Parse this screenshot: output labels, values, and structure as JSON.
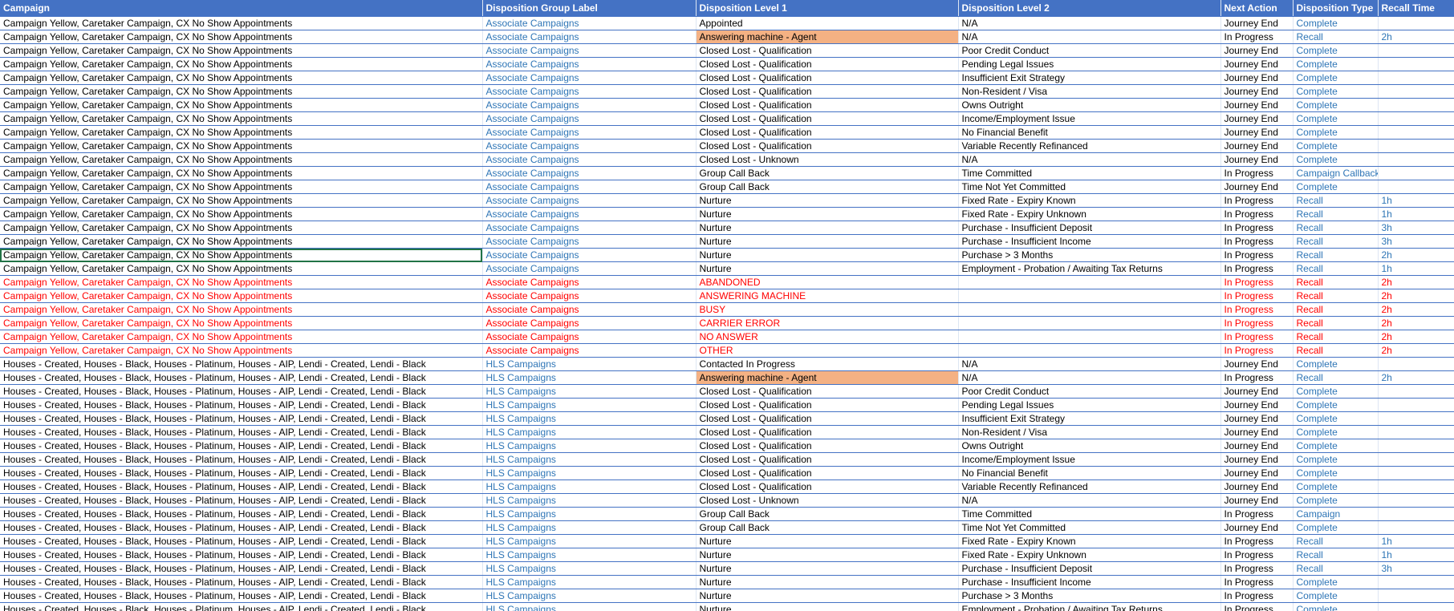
{
  "colors": {
    "header_bg": "#4472c4",
    "link_blue": "#2e75b6",
    "error_red": "#ff0000",
    "highlight": "#f4b183",
    "selection": "#217346"
  },
  "columns": [
    "Campaign",
    "Disposition Group Label",
    "Disposition Level 1",
    "Disposition Level 2",
    "Next Action",
    "Disposition Type",
    "Recall Time"
  ],
  "rows": [
    {
      "c": [
        "Campaign Yellow, Caretaker Campaign, CX No Show Appointments",
        "Associate Campaigns",
        "Appointed",
        "N/A",
        "Journey End",
        "Complete",
        ""
      ]
    },
    {
      "c": [
        "Campaign Yellow, Caretaker Campaign, CX No Show Appointments",
        "Associate Campaigns",
        "Answering machine - Agent",
        "N/A",
        "In Progress",
        "Recall",
        "2h"
      ],
      "hl": true
    },
    {
      "c": [
        "Campaign Yellow, Caretaker Campaign, CX No Show Appointments",
        "Associate Campaigns",
        "Closed Lost - Qualification",
        "Poor Credit Conduct",
        "Journey End",
        "Complete",
        ""
      ]
    },
    {
      "c": [
        "Campaign Yellow, Caretaker Campaign, CX No Show Appointments",
        "Associate Campaigns",
        "Closed Lost - Qualification",
        "Pending Legal Issues",
        "Journey End",
        "Complete",
        ""
      ]
    },
    {
      "c": [
        "Campaign Yellow, Caretaker Campaign, CX No Show Appointments",
        "Associate Campaigns",
        "Closed Lost - Qualification",
        "Insufficient Exit Strategy",
        "Journey End",
        "Complete",
        ""
      ]
    },
    {
      "c": [
        "Campaign Yellow, Caretaker Campaign, CX No Show Appointments",
        "Associate Campaigns",
        "Closed Lost - Qualification",
        "Non-Resident / Visa",
        "Journey End",
        "Complete",
        ""
      ]
    },
    {
      "c": [
        "Campaign Yellow, Caretaker Campaign, CX No Show Appointments",
        "Associate Campaigns",
        "Closed Lost - Qualification",
        "Owns Outright",
        "Journey End",
        "Complete",
        ""
      ]
    },
    {
      "c": [
        "Campaign Yellow, Caretaker Campaign, CX No Show Appointments",
        "Associate Campaigns",
        "Closed Lost - Qualification",
        "Income/Employment Issue",
        "Journey End",
        "Complete",
        ""
      ]
    },
    {
      "c": [
        "Campaign Yellow, Caretaker Campaign, CX No Show Appointments",
        "Associate Campaigns",
        "Closed Lost - Qualification",
        "No Financial Benefit",
        "Journey End",
        "Complete",
        ""
      ]
    },
    {
      "c": [
        "Campaign Yellow, Caretaker Campaign, CX No Show Appointments",
        "Associate Campaigns",
        "Closed Lost - Qualification",
        "Variable Recently Refinanced",
        "Journey End",
        "Complete",
        ""
      ]
    },
    {
      "c": [
        "Campaign Yellow, Caretaker Campaign, CX No Show Appointments",
        "Associate Campaigns",
        "Closed Lost - Unknown",
        "N/A",
        "Journey End",
        "Complete",
        ""
      ]
    },
    {
      "c": [
        "Campaign Yellow, Caretaker Campaign, CX No Show Appointments",
        "Associate Campaigns",
        "Group Call Back",
        "Time Committed",
        "In Progress",
        "Campaign Callback",
        ""
      ]
    },
    {
      "c": [
        "Campaign Yellow, Caretaker Campaign, CX No Show Appointments",
        "Associate Campaigns",
        "Group Call Back",
        "Time Not Yet Committed",
        "Journey End",
        "Complete",
        ""
      ]
    },
    {
      "c": [
        "Campaign Yellow, Caretaker Campaign, CX No Show Appointments",
        "Associate Campaigns",
        "Nurture",
        "Fixed Rate - Expiry Known",
        "In Progress",
        "Recall",
        "1h"
      ]
    },
    {
      "c": [
        "Campaign Yellow, Caretaker Campaign, CX No Show Appointments",
        "Associate Campaigns",
        "Nurture",
        "Fixed Rate - Expiry Unknown",
        "In Progress",
        "Recall",
        "1h"
      ]
    },
    {
      "c": [
        "Campaign Yellow, Caretaker Campaign, CX No Show Appointments",
        "Associate Campaigns",
        "Nurture",
        "Purchase - Insufficient Deposit",
        "In Progress",
        "Recall",
        "3h"
      ]
    },
    {
      "c": [
        "Campaign Yellow, Caretaker Campaign, CX No Show Appointments",
        "Associate Campaigns",
        "Nurture",
        "Purchase - Insufficient Income",
        "In Progress",
        "Recall",
        "3h"
      ]
    },
    {
      "c": [
        "Campaign Yellow, Caretaker Campaign, CX No Show Appointments",
        "Associate Campaigns",
        "Nurture",
        "Purchase > 3 Months",
        "In Progress",
        "Recall",
        "2h"
      ],
      "sel": true
    },
    {
      "c": [
        "Campaign Yellow, Caretaker Campaign, CX No Show Appointments",
        "Associate Campaigns",
        "Nurture",
        "Employment - Probation / Awaiting Tax Returns",
        "In Progress",
        "Recall",
        "1h"
      ]
    },
    {
      "c": [
        "Campaign Yellow, Caretaker Campaign, CX No Show Appointments",
        "Associate Campaigns",
        "ABANDONED",
        "",
        "In Progress",
        "Recall",
        "2h"
      ],
      "red": true
    },
    {
      "c": [
        "Campaign Yellow, Caretaker Campaign, CX No Show Appointments",
        "Associate Campaigns",
        "ANSWERING MACHINE",
        "",
        "In Progress",
        "Recall",
        "2h"
      ],
      "red": true
    },
    {
      "c": [
        "Campaign Yellow, Caretaker Campaign, CX No Show Appointments",
        "Associate Campaigns",
        "BUSY",
        "",
        "In Progress",
        "Recall",
        "2h"
      ],
      "red": true
    },
    {
      "c": [
        "Campaign Yellow, Caretaker Campaign, CX No Show Appointments",
        "Associate Campaigns",
        "CARRIER ERROR",
        "",
        "In Progress",
        "Recall",
        "2h"
      ],
      "red": true
    },
    {
      "c": [
        "Campaign Yellow, Caretaker Campaign, CX No Show Appointments",
        "Associate Campaigns",
        "NO ANSWER",
        "",
        "In Progress",
        "Recall",
        "2h"
      ],
      "red": true
    },
    {
      "c": [
        "Campaign Yellow, Caretaker Campaign, CX No Show Appointments",
        "Associate Campaigns",
        "OTHER",
        "",
        "In Progress",
        "Recall",
        "2h"
      ],
      "red": true
    },
    {
      "c": [
        "Houses - Created, Houses - Black, Houses - Platinum, Houses - AIP, Lendi - Created, Lendi - Black",
        "HLS Campaigns",
        "Contacted In Progress",
        "N/A",
        "Journey End",
        "Complete",
        ""
      ]
    },
    {
      "c": [
        "Houses - Created, Houses - Black, Houses - Platinum, Houses - AIP, Lendi - Created, Lendi - Black",
        "HLS Campaigns",
        "Answering machine - Agent",
        "N/A",
        "In Progress",
        "Recall",
        "2h"
      ],
      "hl": true
    },
    {
      "c": [
        "Houses - Created, Houses - Black, Houses - Platinum, Houses - AIP, Lendi - Created, Lendi - Black",
        "HLS Campaigns",
        "Closed Lost - Qualification",
        "Poor Credit Conduct",
        "Journey End",
        "Complete",
        ""
      ]
    },
    {
      "c": [
        "Houses - Created, Houses - Black, Houses - Platinum, Houses - AIP, Lendi - Created, Lendi - Black",
        "HLS Campaigns",
        "Closed Lost - Qualification",
        "Pending Legal Issues",
        "Journey End",
        "Complete",
        ""
      ]
    },
    {
      "c": [
        "Houses - Created, Houses - Black, Houses - Platinum, Houses - AIP, Lendi - Created, Lendi - Black",
        "HLS Campaigns",
        "Closed Lost - Qualification",
        "Insufficient Exit Strategy",
        "Journey End",
        "Complete",
        ""
      ]
    },
    {
      "c": [
        "Houses - Created, Houses - Black, Houses - Platinum, Houses - AIP, Lendi - Created, Lendi - Black",
        "HLS Campaigns",
        "Closed Lost - Qualification",
        "Non-Resident / Visa",
        "Journey End",
        "Complete",
        ""
      ]
    },
    {
      "c": [
        "Houses - Created, Houses - Black, Houses - Platinum, Houses - AIP, Lendi - Created, Lendi - Black",
        "HLS Campaigns",
        "Closed Lost - Qualification",
        "Owns Outright",
        "Journey End",
        "Complete",
        ""
      ]
    },
    {
      "c": [
        "Houses - Created, Houses - Black, Houses - Platinum, Houses - AIP, Lendi - Created, Lendi - Black",
        "HLS Campaigns",
        "Closed Lost - Qualification",
        "Income/Employment Issue",
        "Journey End",
        "Complete",
        ""
      ]
    },
    {
      "c": [
        "Houses - Created, Houses - Black, Houses - Platinum, Houses - AIP, Lendi - Created, Lendi - Black",
        "HLS Campaigns",
        "Closed Lost - Qualification",
        "No Financial Benefit",
        "Journey End",
        "Complete",
        ""
      ]
    },
    {
      "c": [
        "Houses - Created, Houses - Black, Houses - Platinum, Houses - AIP, Lendi - Created, Lendi - Black",
        "HLS Campaigns",
        "Closed Lost - Qualification",
        "Variable Recently Refinanced",
        "Journey End",
        "Complete",
        ""
      ]
    },
    {
      "c": [
        "Houses - Created, Houses - Black, Houses - Platinum, Houses - AIP, Lendi - Created, Lendi - Black",
        "HLS Campaigns",
        "Closed Lost - Unknown",
        "N/A",
        "Journey End",
        "Complete",
        ""
      ]
    },
    {
      "c": [
        "Houses - Created, Houses - Black, Houses - Platinum, Houses - AIP, Lendi - Created, Lendi - Black",
        "HLS Campaigns",
        "Group Call Back",
        "Time Committed",
        "In Progress",
        "Campaign",
        ""
      ]
    },
    {
      "c": [
        "Houses - Created, Houses - Black, Houses - Platinum, Houses - AIP, Lendi - Created, Lendi - Black",
        "HLS Campaigns",
        "Group Call Back",
        "Time Not Yet Committed",
        "Journey End",
        "Complete",
        ""
      ]
    },
    {
      "c": [
        "Houses - Created, Houses - Black, Houses - Platinum, Houses - AIP, Lendi - Created, Lendi - Black",
        "HLS Campaigns",
        "Nurture",
        "Fixed Rate - Expiry Known",
        "In Progress",
        "Recall",
        "1h"
      ]
    },
    {
      "c": [
        "Houses - Created, Houses - Black, Houses - Platinum, Houses - AIP, Lendi - Created, Lendi - Black",
        "HLS Campaigns",
        "Nurture",
        "Fixed Rate - Expiry Unknown",
        "In Progress",
        "Recall",
        "1h"
      ]
    },
    {
      "c": [
        "Houses - Created, Houses - Black, Houses - Platinum, Houses - AIP, Lendi - Created, Lendi - Black",
        "HLS Campaigns",
        "Nurture",
        "Purchase - Insufficient Deposit",
        "In Progress",
        "Recall",
        "3h"
      ]
    },
    {
      "c": [
        "Houses - Created, Houses - Black, Houses - Platinum, Houses - AIP, Lendi - Created, Lendi - Black",
        "HLS Campaigns",
        "Nurture",
        "Purchase - Insufficient Income",
        "In Progress",
        "Complete",
        ""
      ]
    },
    {
      "c": [
        "Houses - Created, Houses - Black, Houses - Platinum, Houses - AIP, Lendi - Created, Lendi - Black",
        "HLS Campaigns",
        "Nurture",
        "Purchase > 3 Months",
        "In Progress",
        "Complete",
        ""
      ]
    },
    {
      "c": [
        "Houses - Created, Houses - Black, Houses - Platinum, Houses - AIP, Lendi - Created, Lendi - Black",
        "HLS Campaigns",
        "Nurture",
        "Employment - Probation / Awaiting Tax Returns",
        "In Progress",
        "Complete",
        ""
      ]
    }
  ]
}
